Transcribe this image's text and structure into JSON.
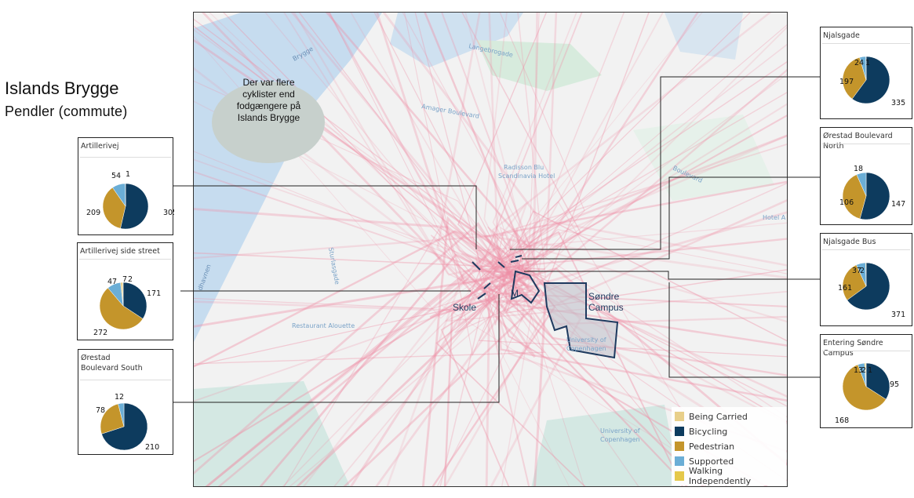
{
  "title": "Islands Brygge",
  "subtitle": "Pendler  (commute)",
  "map": {
    "labels": {
      "skole": "Skole",
      "m": "M",
      "sondre_campus": "Søndre\nCampus",
      "langebrogade": "Langebrogade",
      "amager_boulevard": "Amager Boulevard",
      "radisson": "Radisson Blu\nScandinavia Hotel",
      "hotel_a": "Hotel A",
      "sturlasgade": "Sturlasgade",
      "restaurant": "Restaurant Alouette",
      "univ": "University of\nCopenhagen",
      "univ2": "University of\nCopenhagen",
      "brygge": "Brygge",
      "havnen": "Kalvebod Havnen",
      "amager_boulevard2": "Amager Boulevard",
      "englandsvej": "Englandsvej"
    },
    "bubble_text": "Der var flere cyklister end fodgængere på Islands Brygge"
  },
  "legend": [
    {
      "label": "Being Carried",
      "color": "#e8cf8a"
    },
    {
      "label": "Bicycling",
      "color": "#0d3b5e"
    },
    {
      "label": "Pedestrian",
      "color": "#c4952b"
    },
    {
      "label": "Supported",
      "color": "#6baed6"
    },
    {
      "label": "Walking Independently",
      "color": "#e5c84a"
    }
  ],
  "chart_data": [
    {
      "type": "pie",
      "title": "Artillerivej",
      "slices": [
        {
          "name": "Bicycling",
          "value": 305
        },
        {
          "name": "Pedestrian",
          "value": 209
        },
        {
          "name": "Supported",
          "value": 54
        },
        {
          "name": "Walking Independently",
          "value": 1
        }
      ]
    },
    {
      "type": "pie",
      "title": "Artillerivej side street",
      "slices": [
        {
          "name": "Bicycling",
          "value": 171
        },
        {
          "name": "Pedestrian",
          "value": 272
        },
        {
          "name": "Supported",
          "value": 47
        },
        {
          "name": "Being Carried",
          "value": 7
        },
        {
          "name": "Walking Independently",
          "value": 2
        }
      ]
    },
    {
      "type": "pie",
      "title": "Ørestad Boulevard South",
      "slices": [
        {
          "name": "Bicycling",
          "value": 210
        },
        {
          "name": "Pedestrian",
          "value": 78
        },
        {
          "name": "Supported",
          "value": 12
        }
      ]
    },
    {
      "type": "pie",
      "title": "Njalsgade",
      "slices": [
        {
          "name": "Bicycling",
          "value": 335
        },
        {
          "name": "Pedestrian",
          "value": 197
        },
        {
          "name": "Supported",
          "value": 24
        },
        {
          "name": "Walking Independently",
          "value": 1
        }
      ]
    },
    {
      "type": "pie",
      "title": "Ørestad Boulevard North",
      "slices": [
        {
          "name": "Bicycling",
          "value": 147
        },
        {
          "name": "Pedestrian",
          "value": 106
        },
        {
          "name": "Supported",
          "value": 18
        }
      ]
    },
    {
      "type": "pie",
      "title": "Njalsgade Bus",
      "slices": [
        {
          "name": "Bicycling",
          "value": 371
        },
        {
          "name": "Pedestrian",
          "value": 161
        },
        {
          "name": "Supported",
          "value": 37
        },
        {
          "name": "Walking Independently",
          "value": 2
        }
      ]
    },
    {
      "type": "pie",
      "title": "Entering Søndre Campus",
      "slices": [
        {
          "name": "Bicycling",
          "value": 95
        },
        {
          "name": "Pedestrian",
          "value": 168
        },
        {
          "name": "Supported",
          "value": 13
        },
        {
          "name": "Walking Independently",
          "value": 2
        },
        {
          "name": "Being Carried",
          "value": 1
        }
      ]
    }
  ]
}
